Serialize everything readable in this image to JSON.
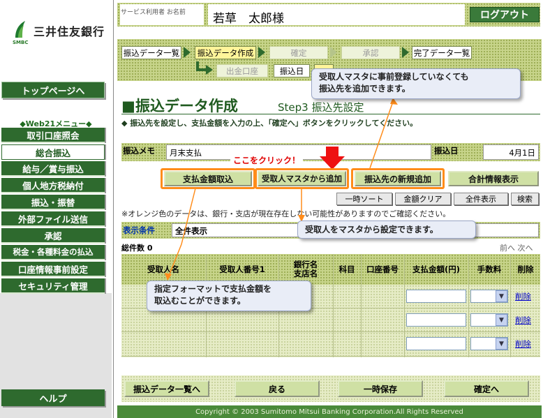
{
  "bank": {
    "name": "三井住友銀行",
    "sub": "SMBC"
  },
  "sidebar": {
    "top_page": "トップページへ",
    "menu_title": "◆Web21メニュー◆",
    "items": [
      {
        "label": "取引口座照会"
      },
      {
        "label": "総合振込"
      },
      {
        "label": "給与／賞与振込"
      },
      {
        "label": "個人地方税納付"
      },
      {
        "label": "振込・振替"
      },
      {
        "label": "外部ファイル送信"
      },
      {
        "label": "承認"
      },
      {
        "label": "税金・各種料金の払込"
      },
      {
        "label": "口座情報事前設定"
      },
      {
        "label": "セキュリティ管理"
      }
    ],
    "active_index": 1,
    "help": "ヘルプ"
  },
  "header": {
    "user_label": "サービス利用者 お名前",
    "user_name": "若草　太郎様",
    "logout": "ログアウト"
  },
  "steps": {
    "main": [
      "振込データ一覧",
      "振込データ作成",
      "確定",
      "承認",
      "完了データ一覧"
    ],
    "sub": [
      "出金口座",
      "振込日"
    ]
  },
  "page": {
    "title": "■振込データ作成",
    "step": "Step3 振込先設定",
    "instruction": "◆ 振込先を設定し、支払金額を入力の上、「確定へ」ボタンをクリックしてください。"
  },
  "memo": {
    "label": "振込メモ",
    "value": "月末支払",
    "date_label": "振込日",
    "date_value": "4月1日"
  },
  "actions": {
    "import": "支払金額取込",
    "from_master": "受取人マスタから追加",
    "add_new": "振込先の新規追加",
    "totals": "合計情報表示",
    "temp_sort": "一時ソート",
    "clear_amount": "金額クリア",
    "show_all": "全件表示",
    "search": "検索",
    "click_here": "ここをクリック！"
  },
  "notice": "※オレンジ色のデータは、銀行・支店が現在存在しない可能性がありますのでご確認ください。",
  "filter": {
    "label": "表示条件",
    "value": "全件表示"
  },
  "table": {
    "count_label": "総件数 0",
    "pager": "前へ 次へ",
    "headers": [
      "受取人名",
      "受取人番号1",
      "銀行名\n支店名",
      "科目",
      "口座番号",
      "支払金額(円)",
      "手数料",
      "削除"
    ],
    "delete_label": "削除"
  },
  "callouts": {
    "c1": "受取人マスタに事前登録していなくても\n振込先を追加できます。",
    "c2": "受取人をマスタから設定できます。",
    "c3": "指定フォーマットで支払金額を\n取込むことができます。"
  },
  "bottom": {
    "list": "振込データ一覧へ",
    "back": "戻る",
    "save": "一時保存",
    "confirm": "確定へ"
  },
  "footer": "Copyright © 2003 Sumitomo Mitsui Banking Corporation.All Rights Reserved"
}
